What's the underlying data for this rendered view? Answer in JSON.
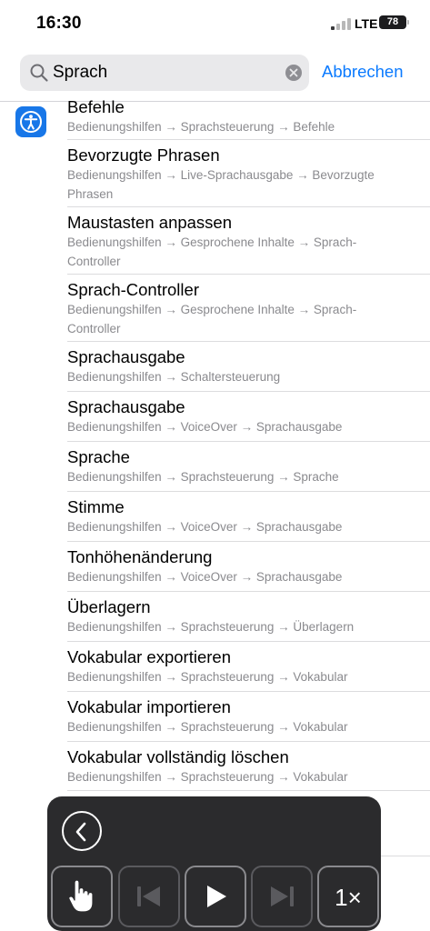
{
  "status_bar": {
    "time": "16:30",
    "network": "LTE",
    "battery": "78"
  },
  "search": {
    "query": "Sprach",
    "cancel_label": "Abbrechen"
  },
  "section_icon": "accessibility-icon",
  "results": [
    {
      "title": "Befehle",
      "path": "Bedienungshilfen → Sprachsteuerung → Befehle"
    },
    {
      "title": "Bevorzugte Phrasen",
      "path": "Bedienungshilfen → Live-Sprachausgabe → Bevorzugte Phrasen"
    },
    {
      "title": "Maustasten anpassen",
      "path": "Bedienungshilfen → Gesprochene Inhalte → Sprach-Controller"
    },
    {
      "title": "Sprach-Controller",
      "path": "Bedienungshilfen → Gesprochene Inhalte → Sprach-Controller"
    },
    {
      "title": "Sprachausgabe",
      "path": "Bedienungshilfen → Schaltersteuerung"
    },
    {
      "title": "Sprachausgabe",
      "path": "Bedienungshilfen → VoiceOver → Sprachausgabe"
    },
    {
      "title": "Sprache",
      "path": "Bedienungshilfen → Sprachsteuerung → Sprache"
    },
    {
      "title": "Stimme",
      "path": "Bedienungshilfen → VoiceOver → Sprachausgabe"
    },
    {
      "title": "Tonhöhenänderung",
      "path": "Bedienungshilfen → VoiceOver → Sprachausgabe"
    },
    {
      "title": "Überlagern",
      "path": "Bedienungshilfen → Sprachsteuerung → Überlagern"
    },
    {
      "title": "Vokabular exportieren",
      "path": "Bedienungshilfen → Sprachsteuerung → Vokabular"
    },
    {
      "title": "Vokabular importieren",
      "path": "Bedienungshilfen → Sprachsteuerung → Vokabular"
    },
    {
      "title": "Vokabular vollständig löschen",
      "path": "Bedienungshilfen → Sprachsteuerung → Vokabular"
    }
  ],
  "controller": {
    "speed_label": "1×",
    "buttons": [
      "back-icon",
      "hand-pointer-icon",
      "skip-back-icon",
      "play-icon",
      "skip-forward-icon"
    ]
  },
  "colors": {
    "accent": "#0a7aff",
    "icon_blue": "#1877e8",
    "controller_bg": "#2b2b2d",
    "secondary_text": "#8a8a8e"
  }
}
